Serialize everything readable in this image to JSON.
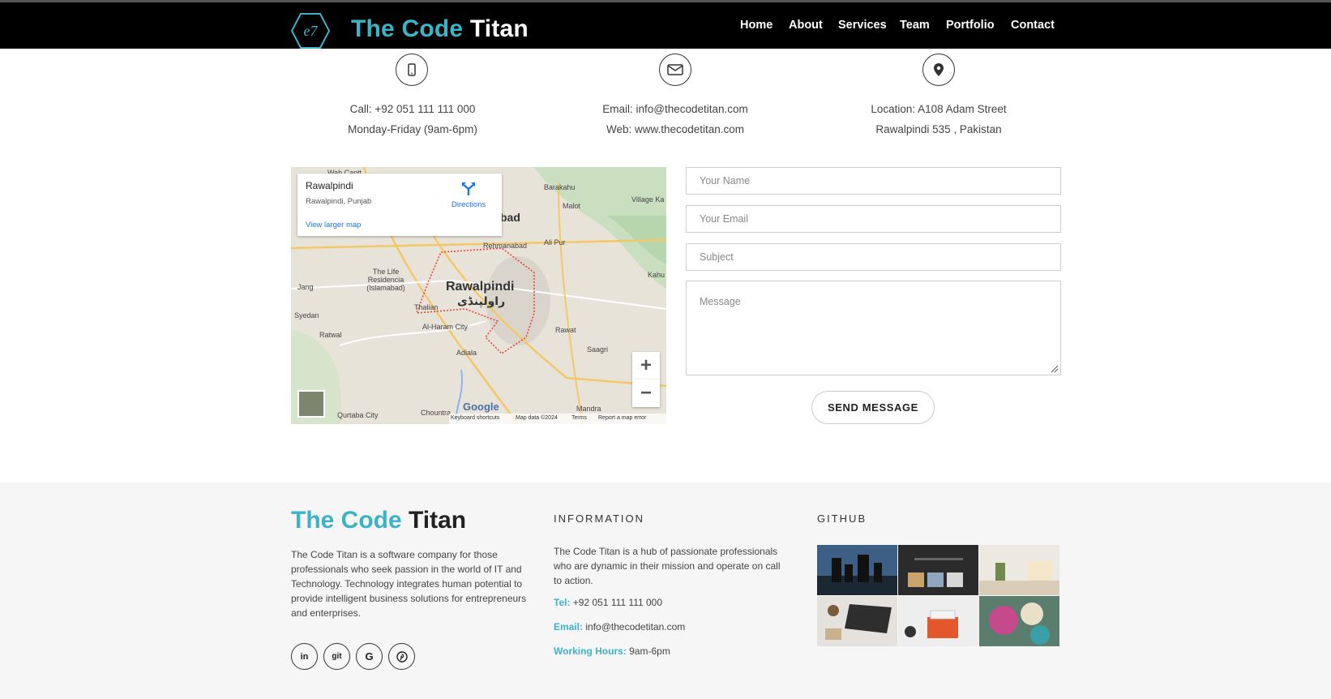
{
  "nav": {
    "brand_part1": "The Code",
    "brand_part2": "Titan",
    "items": [
      "Home",
      "About",
      "Services",
      "Team",
      "Portfolio",
      "Contact"
    ],
    "active": "Contact"
  },
  "contact_info": {
    "phone": {
      "line1": "Call: +92 051 111 111 000",
      "line2": "Monday-Friday (9am-6pm)",
      "icon": "mobile-phone-icon"
    },
    "email": {
      "line1": "Email: info@thecodetitan.com",
      "line2": "Web: www.thecodetitan.com",
      "icon": "envelope-icon"
    },
    "location": {
      "line1": "Location: A108 Adam Street",
      "line2": "Rawalpindi 535 , Pakistan",
      "icon": "map-pin-icon"
    }
  },
  "map": {
    "place_name": "Rawalpindi",
    "place_sub": "Rawalpindi, Punjab",
    "directions_label": "Directions",
    "larger_map_label": "View larger map",
    "city_label": "Rawalpindi",
    "city_label_urdu": "راولپنڈی",
    "labels": [
      "Wah Cantt",
      "Barakahu",
      "Malot",
      "Village Ka",
      "Rehmanabad",
      "Ali Pur",
      "The Life Residencia (Islamabad)",
      "Jang",
      "Thalian",
      "Syedan",
      "Al-Haram City",
      "Ratwal",
      "Rawat",
      "Adiala",
      "Saagri",
      "Kahu",
      "Chountra",
      "Qurtaba City",
      "Mandra",
      "bad"
    ],
    "footer": [
      "Keyboard shortcuts",
      "Map data ©2024",
      "Terms",
      "Report a map error"
    ],
    "google": "Google",
    "zoom_in": "+",
    "zoom_out": "−"
  },
  "form": {
    "name_placeholder": "Your Name",
    "email_placeholder": "Your Email",
    "subject_placeholder": "Subject",
    "message_placeholder": "Message",
    "send_label": "SEND MESSAGE"
  },
  "footer": {
    "brand_part1": "The Code",
    "brand_part2": "Titan",
    "about": "The Code Titan is a software company for those professionals who seek passion in the world of IT and Technology. Technology integrates human potential to provide intelligent business solutions for entrepreneurs and enterprises.",
    "social": [
      "in",
      "git",
      "G",
      "P"
    ],
    "info_heading": "INFORMATION",
    "info_text": "The Code Titan is a hub of passionate professionals who are dynamic in their mission and operate on call to action.",
    "tel_label": "Tel:",
    "tel_value": "+92 051 111 111 000",
    "email_label": "Email:",
    "email_value": "info@thecodetitan.com",
    "hours_label": "Working Hours:",
    "hours_value": "9am-6pm",
    "github_heading": "GITHUB"
  },
  "colors": {
    "accent": "#3db3c8",
    "nav_bg": "#000000",
    "footer_bg": "#f6f6f6"
  }
}
